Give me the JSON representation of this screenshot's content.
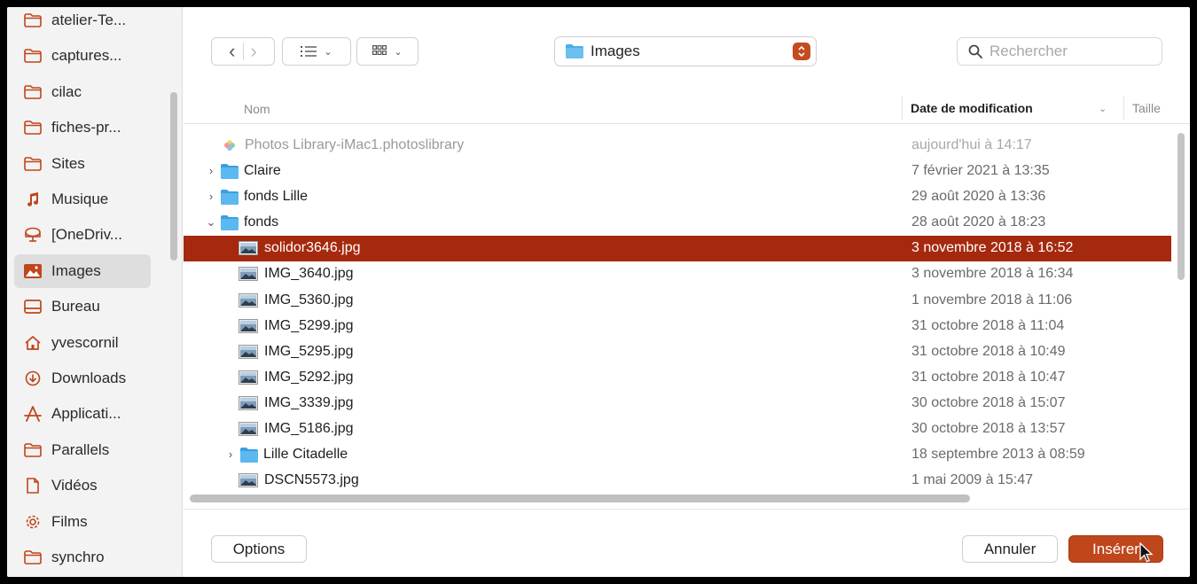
{
  "sidebar": {
    "items": [
      {
        "label": "atelier-Te...",
        "icon": "folder-icon"
      },
      {
        "label": "captures...",
        "icon": "folder-icon"
      },
      {
        "label": "cilac",
        "icon": "folder-icon"
      },
      {
        "label": "fiches-pr...",
        "icon": "folder-icon"
      },
      {
        "label": "Sites",
        "icon": "folder-icon"
      },
      {
        "label": "Musique",
        "icon": "music-note-icon"
      },
      {
        "label": "[OneDriv...",
        "icon": "drive-icon"
      },
      {
        "label": "Images",
        "icon": "photos-icon",
        "active": true
      },
      {
        "label": "Bureau",
        "icon": "desktop-icon"
      },
      {
        "label": "yvescornil",
        "icon": "home-icon"
      },
      {
        "label": "Downloads",
        "icon": "download-icon"
      },
      {
        "label": "Applicati...",
        "icon": "applications-icon"
      },
      {
        "label": "Parallels",
        "icon": "folder-icon"
      },
      {
        "label": "Vidéos",
        "icon": "document-icon"
      },
      {
        "label": "Films",
        "icon": "gear-icon"
      },
      {
        "label": "synchro",
        "icon": "folder-icon"
      }
    ]
  },
  "toolbar": {
    "back": "‹",
    "forward": "›",
    "location": "Images",
    "search_placeholder": "Rechercher"
  },
  "columns": {
    "name": "Nom",
    "date": "Date de modification",
    "size": "Taille"
  },
  "files": [
    {
      "name": "Photos Library-iMac1.photoslibrary",
      "date": "aujourd'hui à 14:17",
      "kind": "library",
      "level": 0,
      "dim": true
    },
    {
      "name": "Claire",
      "date": "7 février 2021 à 13:35",
      "kind": "folder",
      "level": 0,
      "disclosure": "›"
    },
    {
      "name": "fonds Lille",
      "date": "29 août 2020 à 13:36",
      "kind": "folder",
      "level": 0,
      "disclosure": "›"
    },
    {
      "name": "fonds",
      "date": "28 août 2020 à 18:23",
      "kind": "folder",
      "level": 0,
      "disclosure": "⌄"
    },
    {
      "name": "solidor3646.jpg",
      "date": "3 novembre 2018 à 16:52",
      "kind": "image",
      "level": 1,
      "selected": true
    },
    {
      "name": "IMG_3640.jpg",
      "date": "3 novembre 2018 à 16:34",
      "kind": "image",
      "level": 1
    },
    {
      "name": "IMG_5360.jpg",
      "date": "1 novembre 2018 à 11:06",
      "kind": "image",
      "level": 1
    },
    {
      "name": "IMG_5299.jpg",
      "date": "31 octobre 2018 à 11:04",
      "kind": "image",
      "level": 1
    },
    {
      "name": "IMG_5295.jpg",
      "date": "31 octobre 2018 à 10:49",
      "kind": "image",
      "level": 1
    },
    {
      "name": "IMG_5292.jpg",
      "date": "31 octobre 2018 à 10:47",
      "kind": "image",
      "level": 1
    },
    {
      "name": "IMG_3339.jpg",
      "date": "30 octobre 2018 à 15:07",
      "kind": "image",
      "level": 1
    },
    {
      "name": "IMG_5186.jpg",
      "date": "30 octobre 2018 à 13:57",
      "kind": "image",
      "level": 1
    },
    {
      "name": "Lille Citadelle",
      "date": "18 septembre 2013 à 08:59",
      "kind": "folder",
      "level": 1,
      "disclosure": "›"
    },
    {
      "name": "DSCN5573.jpg",
      "date": "1 mai 2009 à 15:47",
      "kind": "image",
      "level": 1
    }
  ],
  "footer": {
    "options": "Options",
    "cancel": "Annuler",
    "insert": "Insérer"
  },
  "colors": {
    "accent": "#c0461b",
    "selection": "#a5290e",
    "folder": "#4aaee8"
  }
}
